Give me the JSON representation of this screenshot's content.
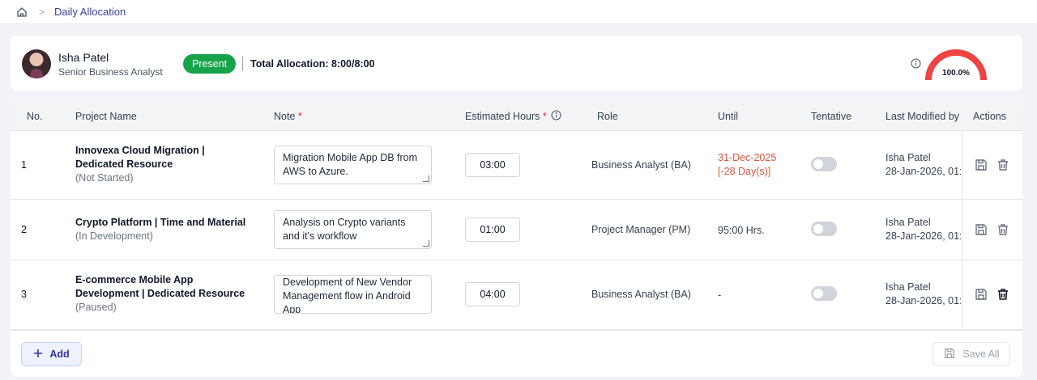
{
  "breadcrumb": {
    "current": "Daily Allocation"
  },
  "employee": {
    "name": "Isha Patel",
    "title": "Senior Business Analyst",
    "status": "Present",
    "total_allocation": "Total Allocation: 8:00/8:00",
    "allocation_percent": "100.0%",
    "gauge_fraction": 1.0
  },
  "table": {
    "headers": {
      "no": "No.",
      "project": "Project Name",
      "note": "Note",
      "hours": "Estimated Hours",
      "role": "Role",
      "until": "Until",
      "tentative": "Tentative",
      "modified": "Last Modified by",
      "actions": "Actions"
    },
    "required_mark": "*",
    "rows": [
      {
        "no": "1",
        "project_line1": "Innovexa Cloud Migration |",
        "project_line2": "Dedicated Resource",
        "project_status": "(Not Started)",
        "note": "Migration Mobile App DB from AWS to Azure.",
        "hours": "03:00",
        "role": "Business Analyst (BA)",
        "until_line1": "31-Dec-2025",
        "until_line2": "[-28 Day(s)]",
        "tentative": false,
        "modified_by": "Isha Patel",
        "modified_on": "28-Jan-2026, 01:"
      },
      {
        "no": "2",
        "project_line1": "Crypto Platform | Time and Material",
        "project_line2": "",
        "project_status": "(In Development)",
        "note": "Analysis on Crypto variants and it's workflow",
        "hours": "01:00",
        "role": "Project Manager (PM)",
        "until_line1": "95:00 Hrs.",
        "until_line2": "",
        "tentative": false,
        "modified_by": "Isha Patel",
        "modified_on": "28-Jan-2026, 01:"
      },
      {
        "no": "3",
        "project_line1": "E-commerce Mobile App",
        "project_line2": "Development | Dedicated Resource",
        "project_status": "(Paused)",
        "note": "Development of New Vendor Management flow in Android App",
        "hours": "04:00",
        "role": "Business Analyst (BA)",
        "until_line1": "-",
        "until_line2": "",
        "tentative": false,
        "modified_by": "Isha Patel",
        "modified_on": "28-Jan-2026, 01:"
      }
    ]
  },
  "footer": {
    "add_label": "Add",
    "save_all_label": "Save All"
  },
  "colors": {
    "accent": "#3b3fa6",
    "present": "#16a34a",
    "gauge": "#ef4444",
    "overdue": "#e5533d"
  }
}
